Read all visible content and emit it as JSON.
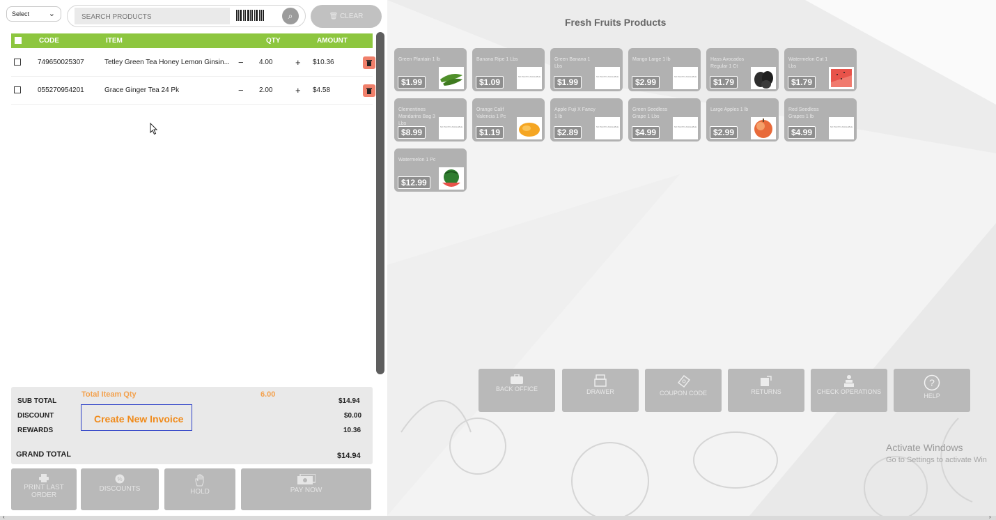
{
  "topbar": {
    "select_value": "Select",
    "search_placeholder": "SEARCH PRODUCTS",
    "clear_label": "CLEAR"
  },
  "cart": {
    "headers": [
      "CODE",
      "ITEM",
      "QTY",
      "AMOUNT"
    ],
    "rows": [
      {
        "code": "749650025307",
        "item": "Tetley Green Tea Honey Lemon Ginsin...",
        "qty": "4.00",
        "amount": "$10.36"
      },
      {
        "code": "055270954201",
        "item": "Grace Ginger Tea 24 Pk",
        "qty": "2.00",
        "amount": "$4.58"
      }
    ]
  },
  "totals": {
    "total_qty_label": "Total Iteam Qty",
    "total_qty_value": "6.00",
    "subtotal_label": "SUB TOTAL",
    "subtotal_value": "$14.94",
    "discount_label": "DISCOUNT",
    "discount_value": "$0.00",
    "rewards_label": "REWARDS",
    "rewards_value": "10.36",
    "grand_total_label": "GRAND TOTAL",
    "grand_total_value": "$14.94",
    "create_invoice_label": "Create New Invoice"
  },
  "bottom_buttons": {
    "print_last_order": "PRINT LAST ORDER",
    "discounts": "DISCOUNTS",
    "hold": "HOLD",
    "pay_now": "PAY NOW"
  },
  "products": {
    "category_title": "Fresh Fruits Products",
    "no_photo_text": "NO PHOTO AVAILABLE",
    "items": [
      {
        "name": "Green Plantain 1 lb",
        "price": "$1.99",
        "image": "plantain-image"
      },
      {
        "name": "Banana Ripe 1 Lbs",
        "price": "$1.09",
        "image": "no-photo"
      },
      {
        "name": "Green Banana 1 Lbs",
        "price": "$1.99",
        "image": "no-photo"
      },
      {
        "name": "Mango Large 1 lb",
        "price": "$2.99",
        "image": "no-photo"
      },
      {
        "name": "Hass Avocados Regular 1 Ct",
        "price": "$1.79",
        "image": "avocado-image"
      },
      {
        "name": "Watermelon Cut 1 Lbs",
        "price": "$1.79",
        "image": "watermelon-cut-image"
      },
      {
        "name": "Clementines Mandarins Bag 3 Lbs",
        "price": "$8.99",
        "image": "no-photo"
      },
      {
        "name": "Orange Calif Valencia 1 Pc",
        "price": "$1.19",
        "image": "orange-image"
      },
      {
        "name": "Apple Fuji X Fancy 1 lb",
        "price": "$2.89",
        "image": "no-photo"
      },
      {
        "name": "Green Seedless Grape 1 Lbs",
        "price": "$4.99",
        "image": "no-photo"
      },
      {
        "name": "Large Apples 1 lb",
        "price": "$2.99",
        "image": "apple-image"
      },
      {
        "name": "Red Seedless Grapes 1 lb",
        "price": "$4.99",
        "image": "no-photo"
      },
      {
        "name": "Watermelon 1 Pc",
        "price": "$12.99",
        "image": "watermelon-image"
      }
    ]
  },
  "actions": {
    "back_office": "BACK OFFICE",
    "drawer": "DRAWER",
    "coupon_code": "COUPON CODE",
    "returns": "RETURNS",
    "check_operations": "CHECK OPERATIONS",
    "help": "HELP"
  },
  "watermark": {
    "line1": "Activate Windows",
    "line2": "Go to Settings to activate Win"
  },
  "colors": {
    "header_green": "#8dc63f",
    "delete_red": "#f0806b",
    "accent_orange": "#f08b1b",
    "tile_gray": "#b1b1b1"
  }
}
